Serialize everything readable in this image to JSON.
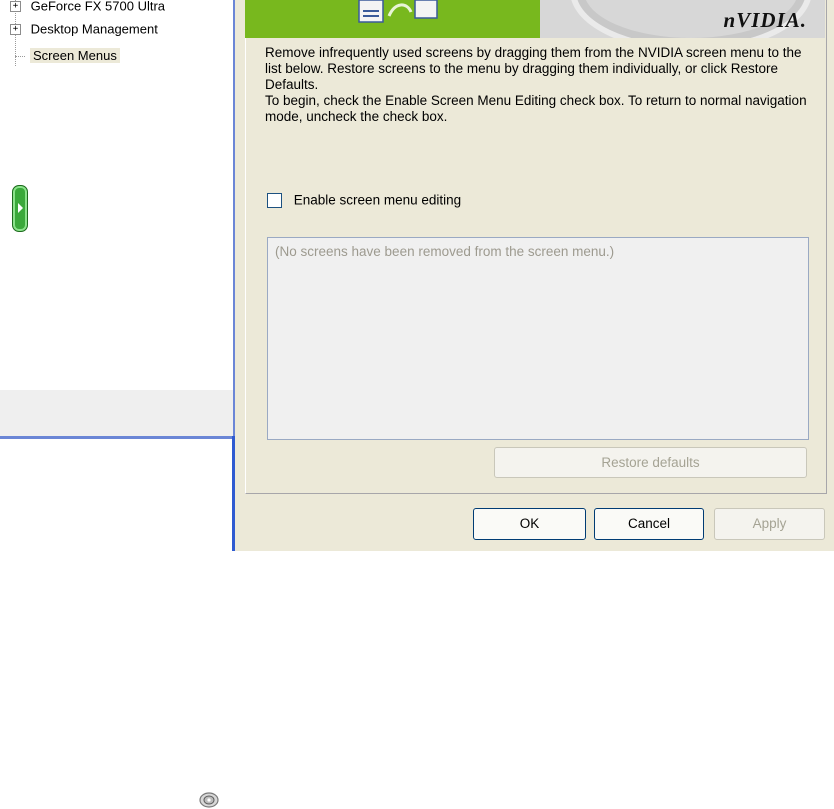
{
  "tree": {
    "items": [
      {
        "label": "GeForce FX 5700 Ultra",
        "expander": "+"
      },
      {
        "label": "Desktop Management",
        "expander": "+"
      },
      {
        "label": "Screen Menus",
        "expander": ""
      }
    ]
  },
  "banner": {
    "logo_text": "nVIDIA."
  },
  "description": {
    "para1": "Remove infrequently used screens by dragging them from the NVIDIA screen menu to the list below.  Restore screens to the menu by dragging them individually, or click Restore Defaults.",
    "para2": "To begin, check the Enable Screen Menu Editing check box. To return to normal navigation mode, uncheck the check box."
  },
  "enable_checkbox": {
    "label": "Enable screen menu editing",
    "checked": false
  },
  "removed_list": {
    "empty_text": "(No screens have been removed from the screen menu.)"
  },
  "buttons": {
    "restore_defaults": "Restore defaults",
    "ok": "OK",
    "cancel": "Cancel",
    "apply": "Apply"
  },
  "colors": {
    "accent_green": "#78b81e",
    "selection_border": "#2f5bd1"
  }
}
